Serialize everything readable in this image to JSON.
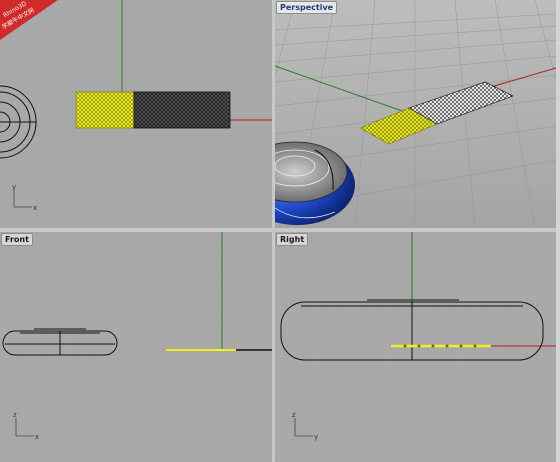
{
  "viewports": {
    "top": {
      "label": ""
    },
    "perspective": {
      "label": "Perspective"
    },
    "front": {
      "label": "Front"
    },
    "right": {
      "label": "Right"
    }
  },
  "axes": {
    "x": "x",
    "y": "y",
    "z": "z"
  },
  "watermark": {
    "line1": "Rhino3D",
    "line2": "学犀牛中文网"
  },
  "colors": {
    "viewport_bg": "#a9a9a9",
    "grid": "#9a9a9a",
    "grid_major": "#8a8a8a",
    "axis_x": "#b02020",
    "axis_y": "#208020",
    "selected": "#f0f020",
    "curve": "#111111"
  }
}
